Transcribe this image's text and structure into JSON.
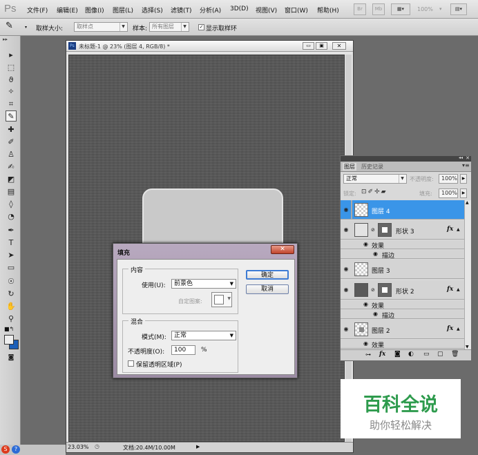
{
  "app": {
    "logo": "Ps"
  },
  "menu": [
    "文件(F)",
    "编辑(E)",
    "图像(I)",
    "图层(L)",
    "选择(S)",
    "滤镜(T)",
    "分析(A)",
    "3D(D)",
    "视图(V)",
    "窗口(W)",
    "帮助(H)"
  ],
  "menubar_right": {
    "br_label": "Br",
    "mb_label": "Mb",
    "zoom": "100%"
  },
  "options": {
    "sample_size_label": "取样大小:",
    "sample_size_value": "取样点",
    "sample_label": "样本:",
    "sample_value": "所有图层",
    "show_ring_label": "显示取样环"
  },
  "document": {
    "title": "未标题-1 @ 23% (图层 4, RGB/8) *",
    "zoom": "23.03%",
    "doc_info": "文档:20.4M/10.00M"
  },
  "dialog": {
    "title": "填充",
    "contents_group": "内容",
    "use_label": "使用(U):",
    "use_value": "前景色",
    "custom_pattern_label": "自定图案:",
    "blending_group": "混合",
    "mode_label": "模式(M):",
    "mode_value": "正常",
    "opacity_label": "不透明度(O):",
    "opacity_value": "100",
    "opacity_unit": "%",
    "preserve_label": "保留透明区域(P)",
    "ok_label": "确定",
    "cancel_label": "取消"
  },
  "layers_panel": {
    "tabs": [
      "图层",
      "历史记录"
    ],
    "blend_mode": "正常",
    "opacity_label": "不透明度:",
    "opacity_value": "100%",
    "lock_label": "锁定:",
    "fill_label": "填充:",
    "fill_value": "100%",
    "fx_label": "fx",
    "effects_label": "效果",
    "stroke_label": "描边",
    "layers": [
      {
        "name": "图层 4",
        "selected": true
      },
      {
        "name": "形状 3",
        "fx": true
      },
      {
        "name": "图层 3"
      },
      {
        "name": "形状 2",
        "fx": true
      },
      {
        "name": "图层 2",
        "fx": true
      }
    ]
  },
  "watermark": {
    "title": "百科全说",
    "subtitle": "助你轻松解决"
  },
  "colors": {
    "selection": "#3a95e8",
    "dialog_frame": "#a897b0",
    "watermark_green": "#2e9b4d"
  }
}
